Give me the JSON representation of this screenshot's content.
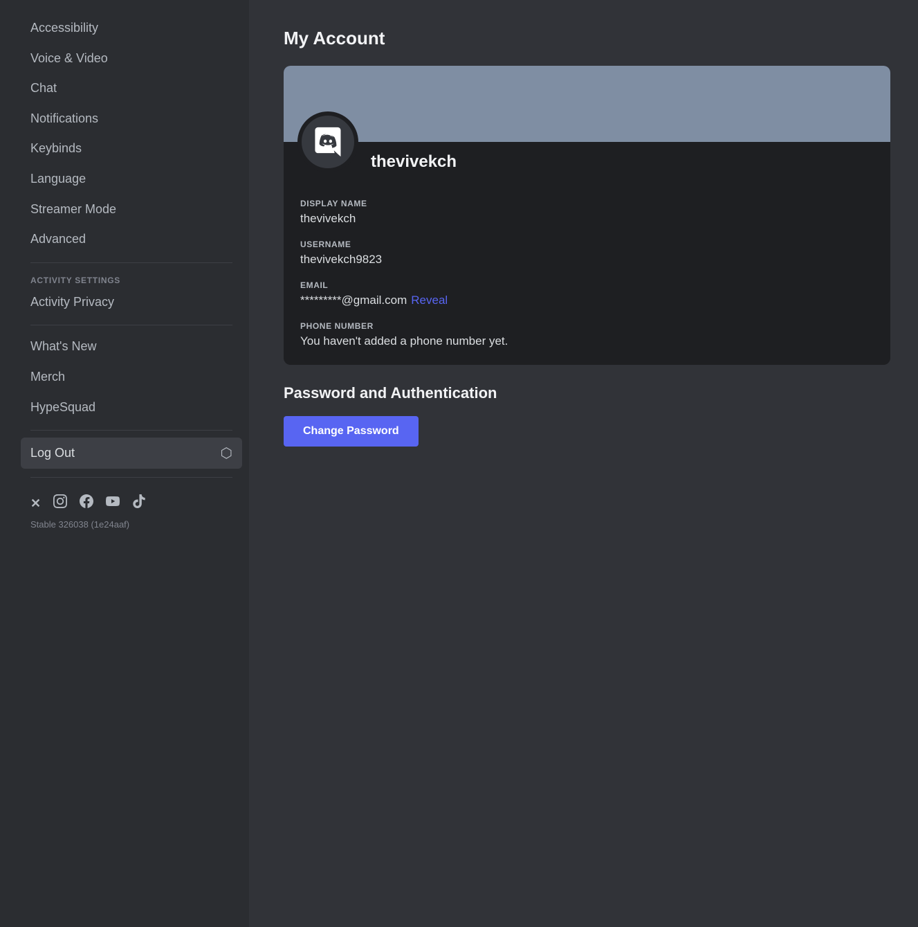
{
  "sidebar": {
    "items": [
      {
        "id": "accessibility",
        "label": "Accessibility",
        "active": false
      },
      {
        "id": "voice-video",
        "label": "Voice & Video",
        "active": false
      },
      {
        "id": "chat",
        "label": "Chat",
        "active": false
      },
      {
        "id": "notifications",
        "label": "Notifications",
        "active": false
      },
      {
        "id": "keybinds",
        "label": "Keybinds",
        "active": false
      },
      {
        "id": "language",
        "label": "Language",
        "active": false
      },
      {
        "id": "streamer-mode",
        "label": "Streamer Mode",
        "active": false
      },
      {
        "id": "advanced",
        "label": "Advanced",
        "active": false
      }
    ],
    "activity_section_label": "ACTIVITY SETTINGS",
    "activity_items": [
      {
        "id": "activity-privacy",
        "label": "Activity Privacy",
        "active": false
      }
    ],
    "extra_items": [
      {
        "id": "whats-new",
        "label": "What's New",
        "active": false
      },
      {
        "id": "merch",
        "label": "Merch",
        "active": false
      },
      {
        "id": "hypesquad",
        "label": "HypeSquad",
        "active": false
      }
    ],
    "logout_label": "Log Out",
    "version": "Stable 326038 (1e24aaf)"
  },
  "main": {
    "page_title": "My Account",
    "profile": {
      "username": "thevivekch",
      "display_name": "thevivekch",
      "username_full": "thevivekch9823",
      "email_masked": "*********@gmail.com",
      "reveal_label": "Reveal",
      "phone_placeholder": "You haven't added a phone number yet."
    },
    "fields": {
      "display_name_label": "DISPLAY NAME",
      "username_label": "USERNAME",
      "email_label": "EMAIL",
      "phone_label": "PHONE NUMBER"
    },
    "password_section": {
      "title": "Password and Authentication",
      "change_password_label": "Change Password"
    }
  },
  "social_icons": [
    {
      "id": "twitter-x",
      "symbol": "𝕏"
    },
    {
      "id": "instagram",
      "symbol": "📷"
    },
    {
      "id": "facebook",
      "symbol": "f"
    },
    {
      "id": "youtube",
      "symbol": "▶"
    },
    {
      "id": "tiktok",
      "symbol": "♪"
    }
  ]
}
